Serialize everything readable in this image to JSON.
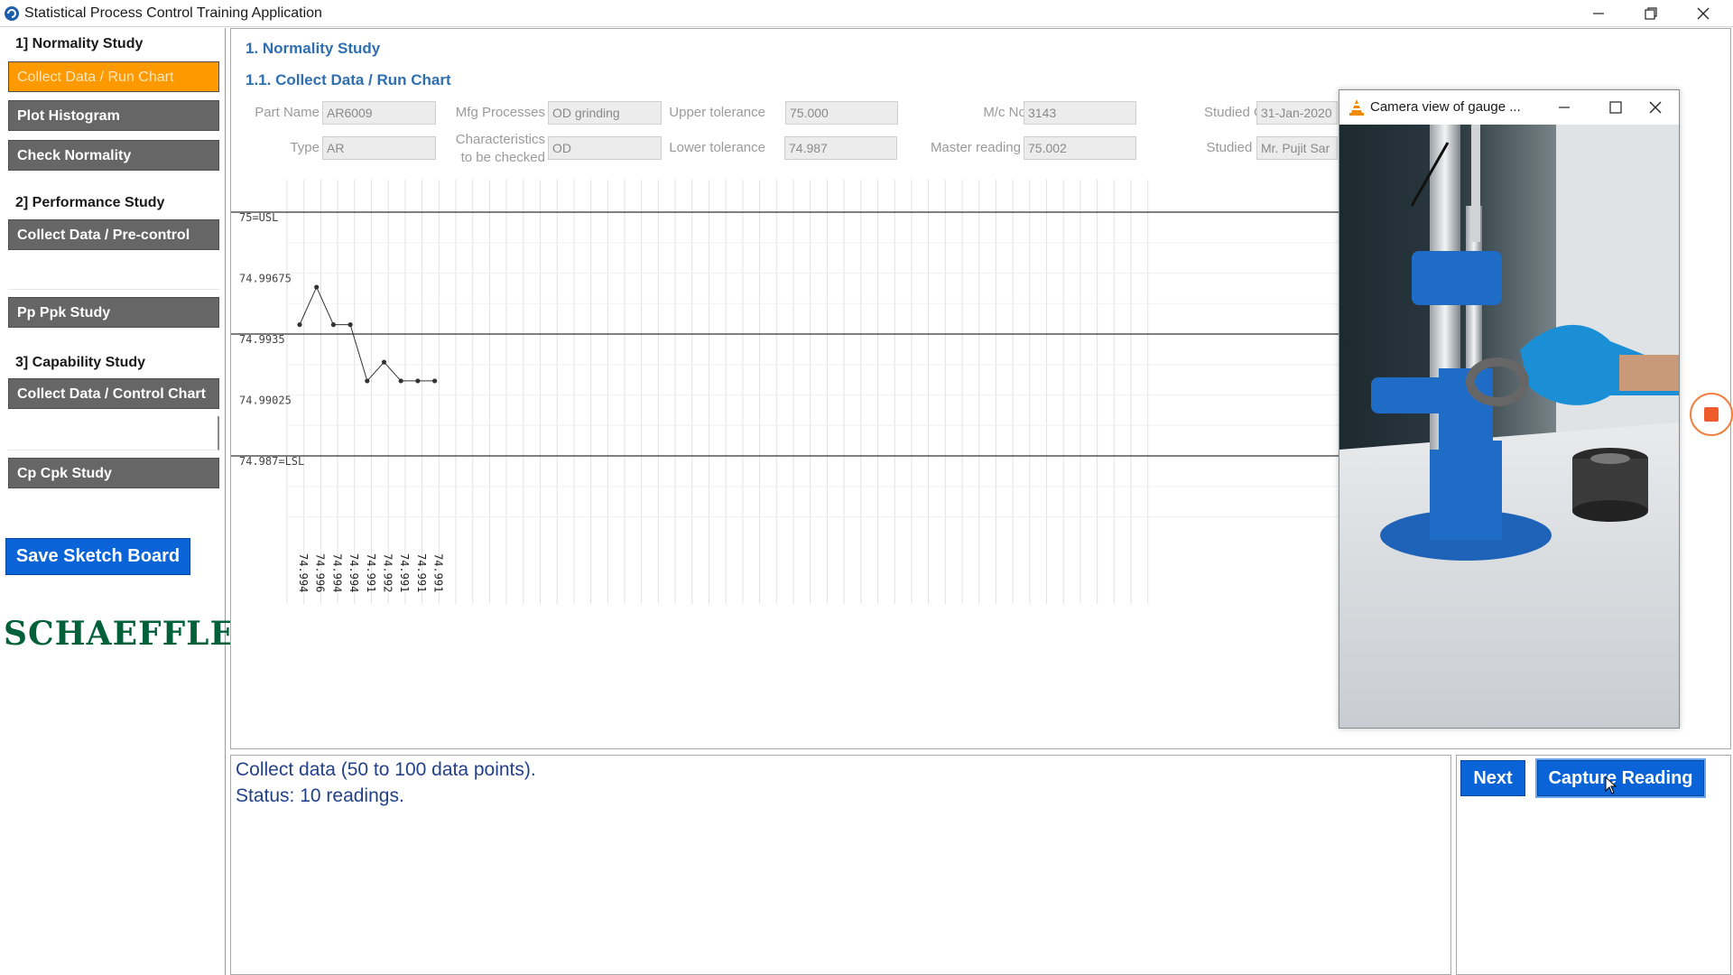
{
  "window": {
    "title": "Statistical Process Control Training Application",
    "minimize_icon": "minimize-icon",
    "restore_icon": "restore-icon",
    "close_icon": "close-icon"
  },
  "sidebar": {
    "sections": [
      {
        "heading": "1] Normality Study",
        "buttons": [
          "Collect Data / Run Chart",
          "Plot Histogram",
          "Check Normality"
        ]
      },
      {
        "heading": "2] Performance Study",
        "buttons": [
          "Collect Data / Pre-control",
          "Pp Ppk Study"
        ]
      },
      {
        "heading": "3] Capability Study",
        "buttons": [
          "Collect Data / Control Chart",
          "Cp Cpk Study"
        ]
      }
    ],
    "save_label": "Save Sketch Board",
    "logo_text": "SCHAEFFLER",
    "active_button": "Collect Data / Run Chart"
  },
  "main": {
    "heading": "1. Normality Study",
    "subheading": "1.1. Collect Data / Run Chart",
    "fields": {
      "part_name": {
        "label": "Part Name",
        "value": "AR6009"
      },
      "type": {
        "label": "Type",
        "value": "AR"
      },
      "mfg_processes": {
        "label": "Mfg Processes",
        "value": "OD grinding"
      },
      "characteristics": {
        "label_1": "Characteristics",
        "label_2": "to be checked",
        "value": "OD"
      },
      "upper_tolerance": {
        "label": "Upper tolerance",
        "value": "75.000"
      },
      "lower_tolerance": {
        "label": "Lower tolerance",
        "value": "74.987"
      },
      "mc_no": {
        "label": "M/c No.",
        "value": "3143"
      },
      "master_reading": {
        "label": "Master reading",
        "value": "75.002"
      },
      "studied_on": {
        "label": "Studied On",
        "value": "31-Jan-2020"
      },
      "studied_by": {
        "label": "Studied By",
        "value": "Mr. Pujit Sar"
      }
    }
  },
  "chart_data": {
    "type": "line",
    "y_ticks": [
      "75=USL",
      "74.99675",
      "74.9935",
      "74.99025",
      "74.987=LSL"
    ],
    "y_tick_values": [
      75.0,
      74.99675,
      74.9935,
      74.99025,
      74.987
    ],
    "ylim": [
      74.987,
      75.0
    ],
    "values": [
      74.994,
      74.996,
      74.994,
      74.994,
      74.991,
      74.992,
      74.991,
      74.991,
      74.991
    ],
    "value_labels": [
      "74.994",
      "74.996",
      "74.994",
      "74.994",
      "74.991",
      "74.992",
      "74.991",
      "74.991",
      "74.991"
    ],
    "reference_lines": [
      "75=USL",
      "74.9935",
      "74.987=LSL"
    ],
    "grid": true,
    "series_color": "#333333"
  },
  "status": {
    "line1": "Collect data (50 to 100 data points).",
    "line2": "Status: 10 readings."
  },
  "actions": {
    "next_label": "Next",
    "capture_label": "Capture Reading"
  },
  "camera": {
    "title": "Camera view of gauge ...",
    "icon": "vlc-cone-icon"
  },
  "colors": {
    "active": "#ff9900",
    "button_gray": "#666666",
    "primary": "#0a64d8",
    "heading_blue": "#2f6fb0",
    "logo_green": "#00603a"
  }
}
